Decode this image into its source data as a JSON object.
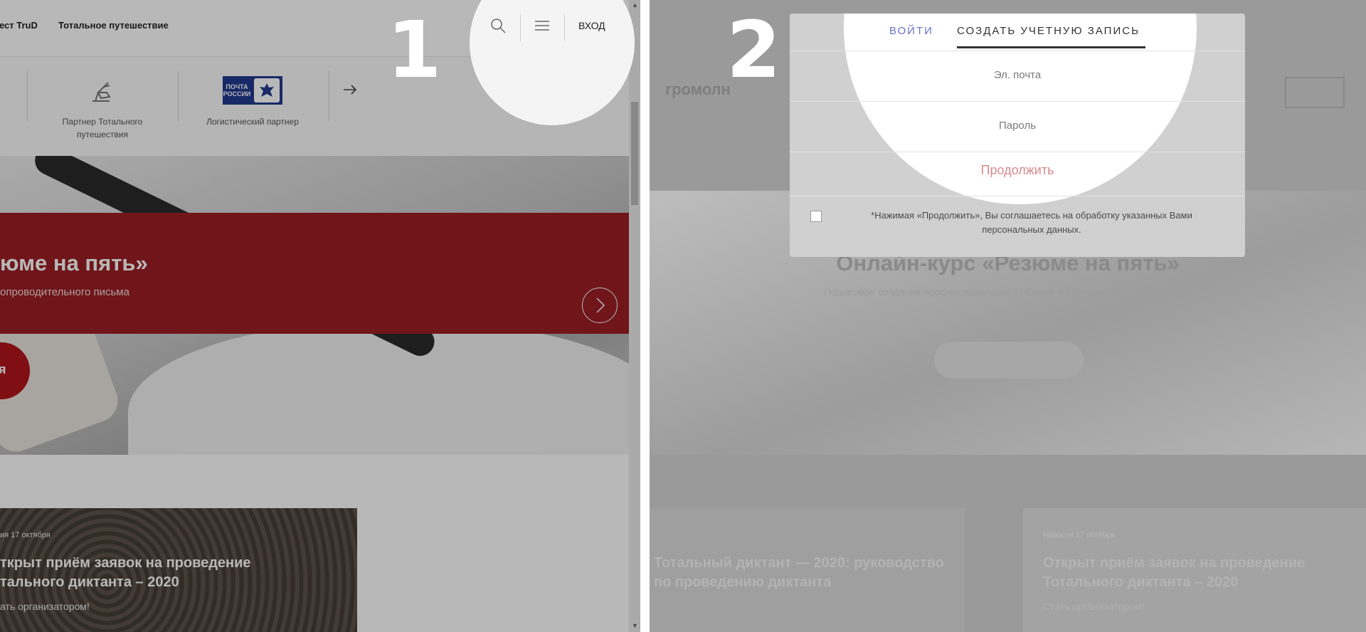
{
  "panel1": {
    "step_number": "1",
    "nav": {
      "links": [
        "ест TruD",
        "Тотальное путешествие"
      ],
      "login_label": "ВХОД"
    },
    "partners": {
      "items": [
        {
          "label": "Партнер Тотального путешествия",
          "line1": "Партнер Тотального",
          "line2": "путешествия",
          "icon": "pelican-logo-icon"
        },
        {
          "label": "Логистический партнер",
          "icon": "pochta-rossii-logo"
        }
      ],
      "pochta_logo_text": "ПОЧТА РОССИИ"
    },
    "hero": {
      "title": "юме на пять»",
      "subtitle": "опроводительного письма",
      "cta_fragment": "я"
    },
    "news_card": {
      "date": "ия 17 октября",
      "title_line1": "ткрыт приём заявок на проведение",
      "title_line2": "тального диктанта – 2020",
      "link": "ать организатором!"
    }
  },
  "panel2": {
    "step_number": "2",
    "brand": "громолн",
    "hero": {
      "title": "Онлайн-курс «Резюме на пять»",
      "subtitle": "Пошаговое создание профессионального резюме и сопроводительного письма"
    },
    "cards": [
      {
        "title_line1": "Тотальный диктант — 2020: руководство",
        "title_line2": "по проведению диктанта"
      },
      {
        "date": "Новости 17 октября",
        "title_line1": "Открыт приём заявок на проведение",
        "title_line2": "Тотального диктанта – 2020",
        "link": "Стать организатором!"
      }
    ],
    "modal": {
      "tabs": [
        {
          "label": "ВОЙТИ",
          "active": false
        },
        {
          "label": "СОЗДАТЬ УЧЕТНУЮ ЗАПИСЬ",
          "active": true
        }
      ],
      "email_placeholder": "Эл. почта",
      "password_placeholder": "Пароль",
      "continue_label": "Продолжить",
      "consent_line1": "*Нажимая «Продолжить», Вы соглашаетесь на обработку указанных Вами",
      "consent_line2": "персональных данных."
    }
  },
  "colors": {
    "brand_red": "#9b1f24",
    "tab_active_text": "#333333",
    "tab_inactive_text": "#6b73c6",
    "continue_text": "#d98a8a"
  }
}
